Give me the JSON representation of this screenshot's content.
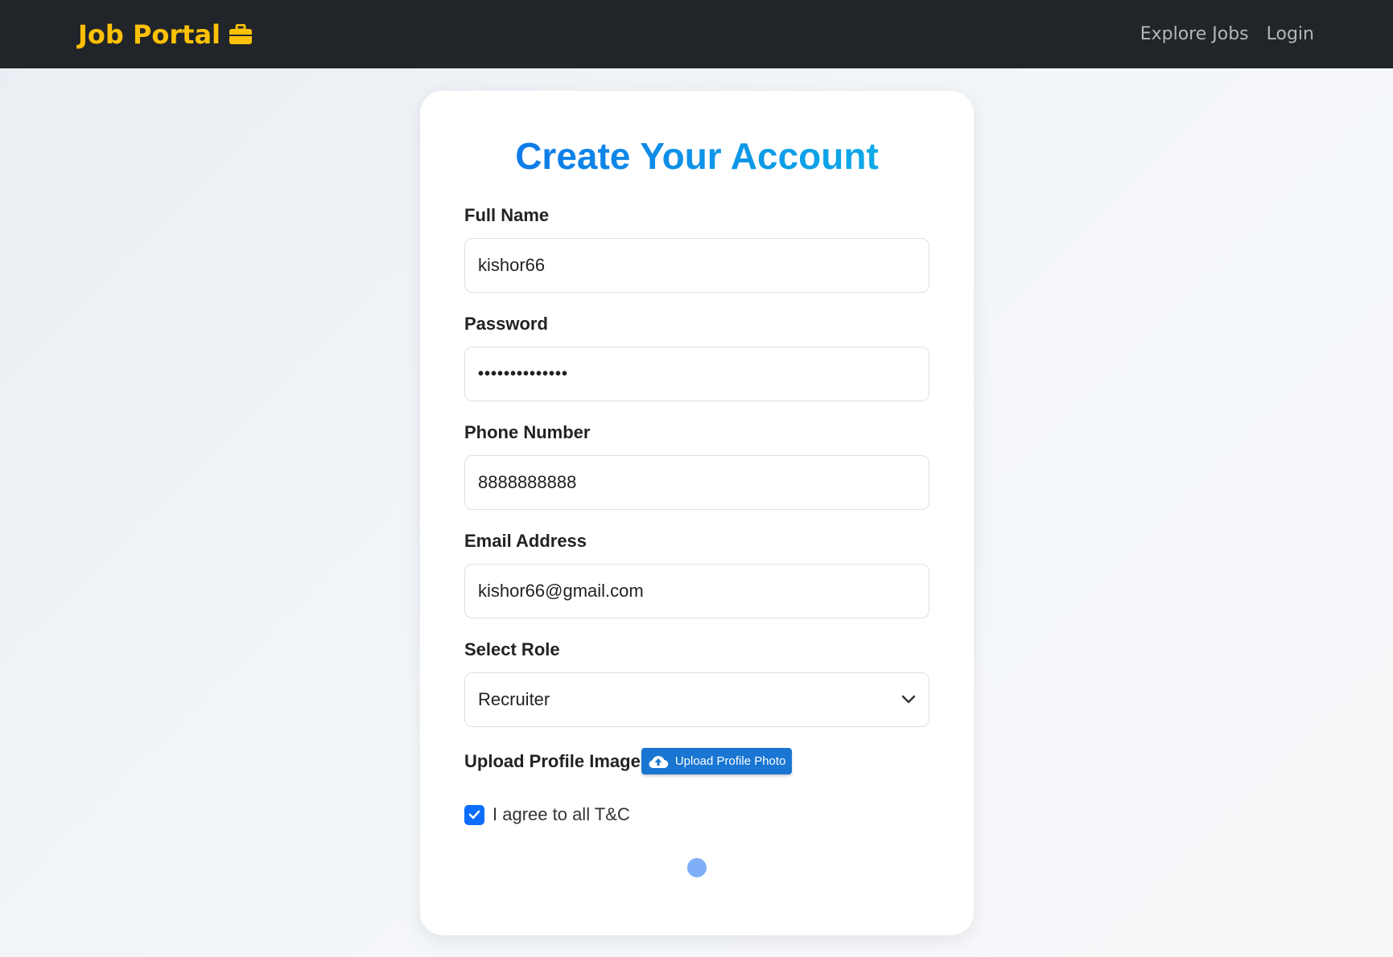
{
  "navbar": {
    "brand": "Job Portal",
    "brand_icon": "briefcase-icon",
    "links": [
      "Explore Jobs",
      "Login"
    ]
  },
  "form": {
    "title": "Create Your Account",
    "full_name": {
      "label": "Full Name",
      "value": "kishor66"
    },
    "password": {
      "label": "Password",
      "value": "••••••••••••••"
    },
    "phone": {
      "label": "Phone Number",
      "value": "8888888888"
    },
    "email": {
      "label": "Email Address",
      "value": "kishor66@gmail.com"
    },
    "role": {
      "label": "Select Role",
      "value": "Recruiter"
    },
    "upload": {
      "label": "Upload Profile Image",
      "button": "Upload Profile Photo",
      "icon": "cloud-upload-icon"
    },
    "terms": {
      "label": "I agree to all T&C",
      "checked": true
    }
  },
  "colors": {
    "navbar_bg": "#212529",
    "brand": "#ffc107",
    "title_gradient_start": "#0d74e8",
    "title_gradient_end": "#0fb0e8",
    "upload_button": "#1976d2",
    "checkbox": "#0d6efd",
    "spinner": "#7fb0f7"
  }
}
